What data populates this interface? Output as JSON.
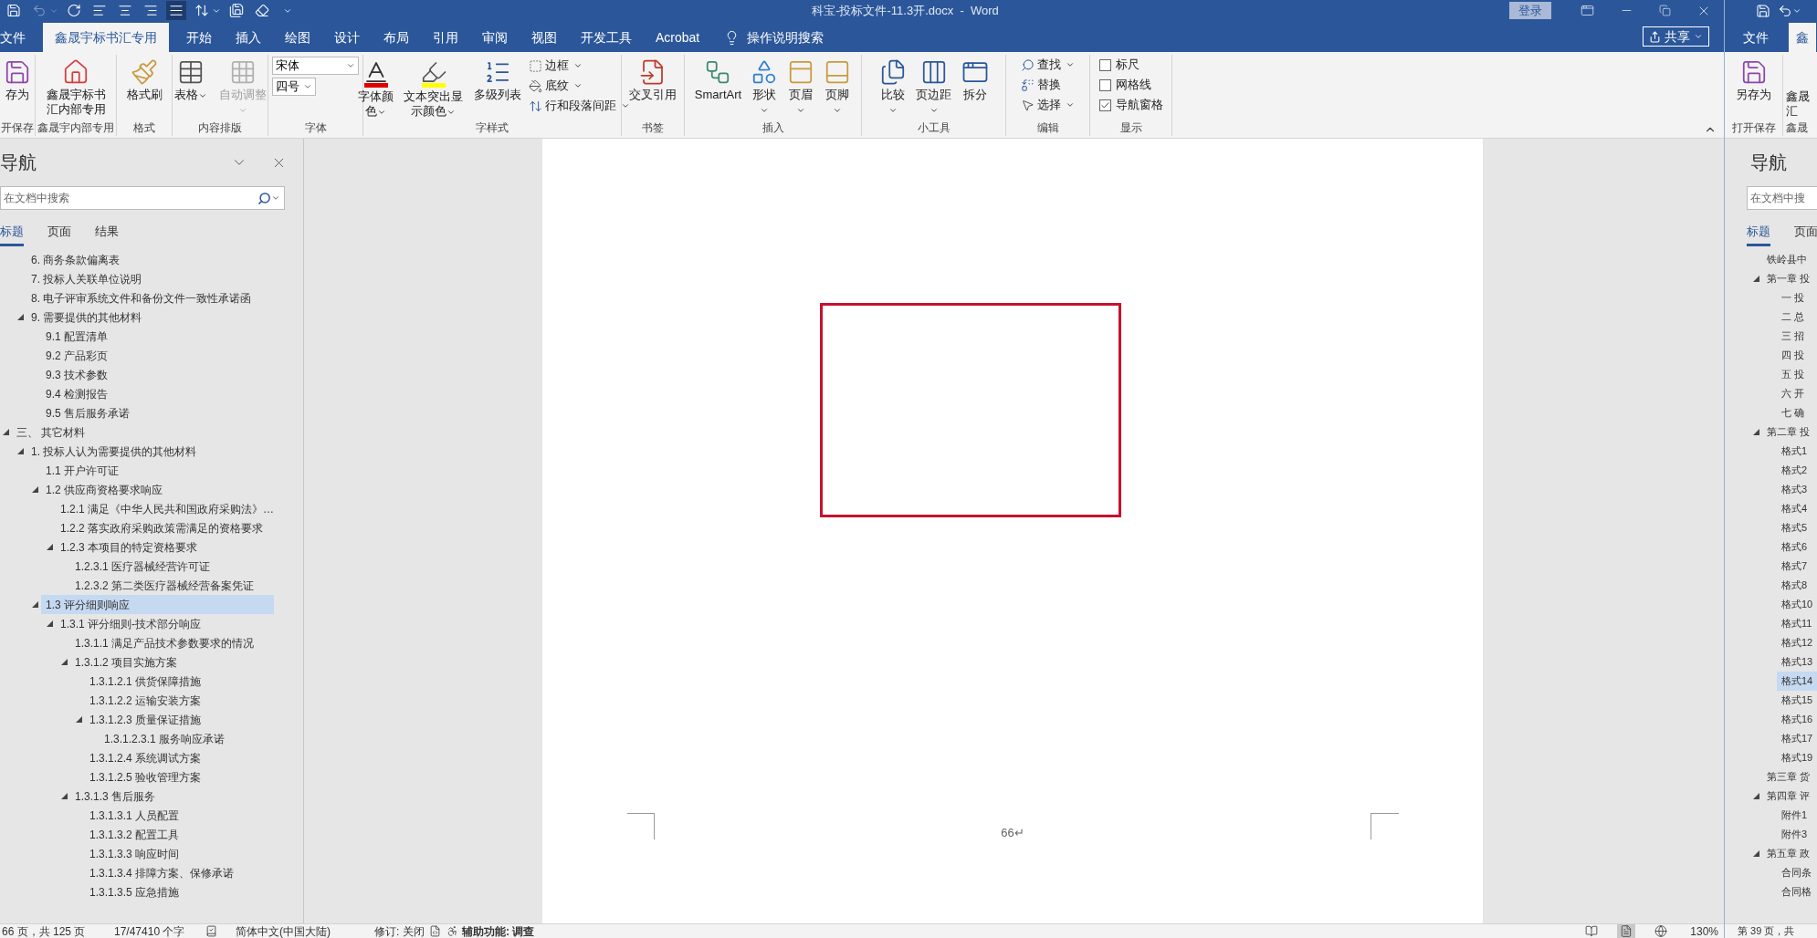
{
  "left_window": {
    "quick_access": [
      {
        "disabled": false,
        "selected": false
      },
      {
        "disabled": true,
        "selected": false
      },
      {
        "disabled": false,
        "selected": false
      },
      {
        "disabled": false,
        "selected": false
      },
      {
        "disabled": false,
        "selected": false
      },
      {
        "disabled": false,
        "selected": false
      },
      {
        "disabled": false,
        "selected": true
      },
      {
        "disabled": false,
        "selected": false
      },
      {
        "disabled": false,
        "selected": false
      },
      {
        "disabled": false,
        "selected": false
      }
    ],
    "title": "科宝-投标文件-11.3开.docx  -  Word",
    "login": "登录",
    "tabs": [
      {
        "label": "文件",
        "selected": false
      },
      {
        "label": "鑫晟宇标书汇专用",
        "selected": true
      },
      {
        "label": "开始",
        "selected": false
      },
      {
        "label": "插入",
        "selected": false
      },
      {
        "label": "绘图",
        "selected": false
      },
      {
        "label": "设计",
        "selected": false
      },
      {
        "label": "布局",
        "selected": false
      },
      {
        "label": "引用",
        "selected": false
      },
      {
        "label": "审阅",
        "selected": false
      },
      {
        "label": "视图",
        "selected": false
      },
      {
        "label": "开发工具",
        "selected": false
      },
      {
        "label": "Acrobat",
        "selected": false
      }
    ],
    "tell_me": "操作说明搜索",
    "share": "共享",
    "ribbon": [
      {
        "label": "开保存",
        "items": [
          {
            "label": "存为"
          }
        ]
      },
      {
        "label": "鑫晟宇内部专用",
        "items": [
          {
            "label": "鑫晟宇标书汇内部专用"
          }
        ]
      },
      {
        "label": "格式",
        "items": [
          {
            "label": "格式刷"
          }
        ]
      },
      {
        "label": "内容排版",
        "items": [
          {
            "label": "表格",
            "disabled": false
          },
          {
            "label": "自动调整",
            "disabled": true
          }
        ]
      },
      {
        "label": "字体",
        "items": [
          {
            "value": "宋体"
          },
          {
            "value": "四号"
          }
        ]
      },
      {
        "label": "字样式",
        "items": [
          {
            "label": "字体颜色"
          },
          {
            "label": "文本突出显示颜色"
          },
          {
            "label": "多级列表"
          },
          {
            "label": "边框"
          },
          {
            "label": "底纹"
          },
          {
            "label": "行和段落间距"
          }
        ]
      },
      {
        "label": "书签",
        "items": [
          {
            "label": "交叉引用"
          }
        ]
      },
      {
        "label": "插入",
        "items": [
          {
            "label": "SmartArt"
          },
          {
            "label": "形状"
          },
          {
            "label": "页眉"
          },
          {
            "label": "页脚"
          }
        ]
      },
      {
        "label": "小工具",
        "items": [
          {
            "label": "比较"
          },
          {
            "label": "页边距"
          },
          {
            "label": "拆分"
          }
        ]
      },
      {
        "label": "编辑",
        "items": [
          {
            "label": "查找"
          },
          {
            "label": "替换"
          },
          {
            "label": "选择"
          }
        ]
      },
      {
        "label": "显示",
        "items": [
          {
            "label": "标尺",
            "checked": false
          },
          {
            "label": "网格线",
            "checked": false
          },
          {
            "label": "导航窗格",
            "checked": true
          }
        ]
      }
    ],
    "nav": {
      "title": "导航",
      "search": {
        "placeholder": "在文档中搜索"
      },
      "tabs": [
        {
          "label": "标题",
          "selected": true
        },
        {
          "label": "页面",
          "selected": false
        },
        {
          "label": "结果",
          "selected": false
        }
      ],
      "headings": [
        {
          "children": [
            {
              "label": "6. 商务条款偏离表",
              "selected": false
            },
            {
              "label": "7. 投标人关联单位说明",
              "selected": false
            },
            {
              "label": "8. 电子评审系统文件和备份文件一致性承诺函",
              "selected": false
            },
            {
              "label": "9. 需要提供的其他材料",
              "selected": false,
              "expanded": true,
              "children": [
                {
                  "label": "9.1 配置清单",
                  "selected": false
                },
                {
                  "label": "9.2 产品彩页",
                  "selected": false
                },
                {
                  "label": "9.3 技术参数",
                  "selected": false
                },
                {
                  "label": "9.4 检测报告",
                  "selected": false
                },
                {
                  "label": "9.5 售后服务承诺",
                  "selected": false
                }
              ]
            }
          ]
        },
        {
          "label": "三、 其它材料",
          "selected": false,
          "expanded": true,
          "children": [
            {
              "label": "1. 投标人认为需要提供的其他材料",
              "selected": false,
              "expanded": true,
              "children": [
                {
                  "label": "1.1 开户许可证",
                  "selected": false
                },
                {
                  "label": "1.2 供应商资格要求响应",
                  "selected": false,
                  "expanded": true,
                  "children": [
                    {
                      "label": "1.2.1 满足《中华人民共和国政府采购法》…",
                      "selected": false
                    },
                    {
                      "label": "1.2.2 落实政府采购政策需满足的资格要求",
                      "selected": false
                    },
                    {
                      "label": "1.2.3 本项目的特定资格要求",
                      "selected": false,
                      "expanded": true,
                      "children": [
                        {
                          "label": "1.2.3.1 医疗器械经营许可证",
                          "selected": false
                        },
                        {
                          "label": "1.2.3.2 第二类医疗器械经营备案凭证",
                          "selected": false
                        }
                      ]
                    }
                  ]
                },
                {
                  "label": "1.3 评分细则响应",
                  "selected": true,
                  "expanded": true,
                  "children": [
                    {
                      "label": "1.3.1 评分细则-技术部分响应",
                      "selected": false,
                      "expanded": true,
                      "children": [
                        {
                          "label": "1.3.1.1 满足产品技术参数要求的情况",
                          "selected": false
                        },
                        {
                          "label": "1.3.1.2 项目实施方案",
                          "selected": false,
                          "expanded": true,
                          "children": [
                            {
                              "label": "1.3.1.2.1 供货保障措施",
                              "selected": false
                            },
                            {
                              "label": "1.3.1.2.2 运输安装方案",
                              "selected": false
                            },
                            {
                              "label": "1.3.1.2.3 质量保证措施",
                              "selected": false,
                              "expanded": true,
                              "children": [
                                {
                                  "label": "1.3.1.2.3.1 服务响应承诺",
                                  "selected": false
                                }
                              ]
                            },
                            {
                              "label": "1.3.1.2.4 系统调试方案",
                              "selected": false
                            },
                            {
                              "label": "1.3.1.2.5 验收管理方案",
                              "selected": false
                            }
                          ]
                        },
                        {
                          "label": "1.3.1.3 售后服务",
                          "selected": false,
                          "expanded": true,
                          "children": [
                            {
                              "label": "1.3.1.3.1 人员配置",
                              "selected": false
                            },
                            {
                              "label": "1.3.1.3.2 配置工具",
                              "selected": false
                            },
                            {
                              "label": "1.3.1.3.3 响应时间",
                              "selected": false
                            },
                            {
                              "label": "1.3.1.3.4 排障方案、保修承诺",
                              "selected": false
                            },
                            {
                              "label": "1.3.1.3.5 应急措施",
                              "selected": false
                            }
                          ]
                        }
                      ]
                    }
                  ]
                }
              ]
            }
          ]
        }
      ]
    },
    "page": {
      "page_number": "66↵"
    },
    "status_bar": {
      "page": "66 页，共 125 页",
      "words": "17/47410 个字",
      "language": "简体中文(中国大陆)",
      "track_changes": "修订: 关闭",
      "accessibility": "辅助功能: 调查",
      "views": [
        {
          "selected": false
        },
        {
          "selected": true
        },
        {
          "selected": false
        }
      ],
      "zoom": "130%"
    }
  },
  "right_window": {
    "tabs": [
      {
        "label": "文件",
        "selected": false
      },
      {
        "label": "鑫",
        "selected": true
      }
    ],
    "ribbon": [
      {
        "label": "打开保存",
        "items": [
          {
            "label": "另存为"
          }
        ]
      },
      {
        "label": "鑫晟",
        "items": [
          {
            "lines": [
              "鑫晟",
              "汇"
            ]
          }
        ]
      }
    ],
    "nav": {
      "title": "导航",
      "search": {
        "placeholder": "在文档中搜"
      },
      "tabs": [
        {
          "label": "标题",
          "selected": true
        },
        {
          "label": "页面",
          "selected": false
        }
      ],
      "headings": [
        {
          "label": "铁岭县中",
          "selected": false
        },
        {
          "label": "第一章 投",
          "selected": false,
          "expanded": true,
          "children": [
            {
              "label": "一 投",
              "selected": false
            },
            {
              "label": "二 总",
              "selected": false
            },
            {
              "label": "三 招",
              "selected": false
            },
            {
              "label": "四 投",
              "selected": false
            },
            {
              "label": "五 投",
              "selected": false
            },
            {
              "label": "六 开",
              "selected": false
            },
            {
              "label": "七 确",
              "selected": false
            }
          ]
        },
        {
          "label": "第二章 投",
          "selected": false,
          "expanded": true,
          "children": [
            {
              "label": "格式1",
              "selected": false
            },
            {
              "label": "格式2",
              "selected": false
            },
            {
              "label": "格式3",
              "selected": false
            },
            {
              "label": "格式4",
              "selected": false
            },
            {
              "label": "格式5",
              "selected": false
            },
            {
              "label": "格式6",
              "selected": false
            },
            {
              "label": "格式7",
              "selected": false
            },
            {
              "label": "格式8",
              "selected": false
            },
            {
              "label": "格式10",
              "selected": false
            },
            {
              "label": "格式11",
              "selected": false
            },
            {
              "label": "格式12",
              "selected": false
            },
            {
              "label": "格式13",
              "selected": false
            },
            {
              "label": "格式14",
              "selected": true
            },
            {
              "label": "格式15",
              "selected": false
            },
            {
              "label": "格式16",
              "selected": false
            },
            {
              "label": "格式17",
              "selected": false
            },
            {
              "label": "格式19",
              "selected": false
            }
          ]
        },
        {
          "label": "第三章 货",
          "selected": false
        },
        {
          "label": "第四章 评",
          "selected": false,
          "expanded": true,
          "children": [
            {
              "label": "附件1",
              "selected": false
            },
            {
              "label": "附件3",
              "selected": false
            }
          ]
        },
        {
          "label": "第五章 政",
          "selected": false,
          "expanded": true,
          "children": [
            {
              "label": "合同条",
              "selected": false
            },
            {
              "label": "合同格",
              "selected": false
            }
          ]
        }
      ]
    },
    "status_bar": {
      "page": "第 39 页，共"
    }
  }
}
